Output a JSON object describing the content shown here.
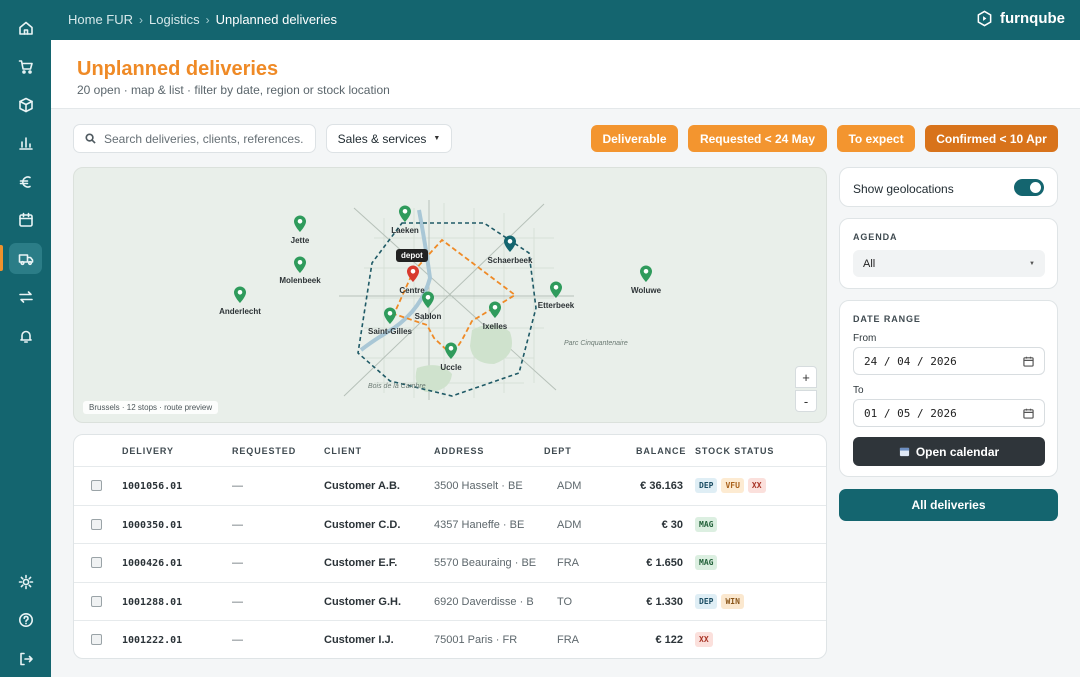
{
  "app": {
    "brand": "furnqube",
    "breadcrumb": [
      "Home FUR",
      "Logistics",
      "Unplanned deliveries"
    ]
  },
  "sidebar": {
    "items": [
      {
        "icon": "home-icon"
      },
      {
        "icon": "cart-icon"
      },
      {
        "icon": "box-icon"
      },
      {
        "icon": "bar-chart-icon"
      },
      {
        "icon": "euro-icon"
      },
      {
        "icon": "calendar-icon"
      },
      {
        "icon": "truck-icon",
        "active": true
      },
      {
        "icon": "transfer-icon"
      },
      {
        "icon": "bell-icon"
      },
      {
        "icon": "sun-icon"
      },
      {
        "icon": "help-icon"
      },
      {
        "icon": "logout-icon"
      }
    ]
  },
  "header": {
    "title": "Unplanned deliveries",
    "subtitle": "20 open · map & list · filter by date, region or stock location"
  },
  "toolbar": {
    "search_placeholder": "Search deliveries, clients, references...",
    "select_label": "Sales & services",
    "filters": [
      "Deliverable",
      "Requested < 24 May",
      "To expect",
      "Confirmed < 10 Apr"
    ]
  },
  "map": {
    "depot_label": "depot",
    "locations": {
      "laeken": "Laeken",
      "jette": "Jette",
      "molenbeek": "Molenbeek",
      "anderlecht": "Anderlecht",
      "schaerbeek": "Schaerbeek",
      "centre": "Centre",
      "sablon": "Sablon",
      "etterbeek": "Etterbeek",
      "woluwe": "Woluwe",
      "saint_gilles": "Saint-Gilles",
      "ixelles": "Ixelles",
      "uccle": "Uccle"
    },
    "parks": {
      "cinquantenaire": "Parc Cinquantenaire",
      "cambre": "Bois de la Cambre"
    },
    "caption": "Brussels · 12 stops · route preview",
    "zoom_in": "+",
    "zoom_out": "-",
    "colors": {
      "pin": "#2f9b5c",
      "depot": "#d83a2e",
      "schaerbeek": "#14656f",
      "route": "#ef8a26",
      "zone": "#1f5a66"
    }
  },
  "table": {
    "columns": [
      "DELIVERY",
      "REQUESTED",
      "CLIENT",
      "ADDRESS",
      "DEPT",
      "BALANCE",
      "STOCK STATUS"
    ],
    "rows": [
      {
        "delivery": "1001056.01",
        "requested": "—",
        "client": "Customer A.B.",
        "address": "3500 Hasselt · BE",
        "dept": "ADM",
        "balance": "€ 36.163",
        "stock": [
          "DEP",
          "VFU",
          "XX"
        ]
      },
      {
        "delivery": "1000350.01",
        "requested": "—",
        "client": "Customer C.D.",
        "address": "4357 Haneffe · BE",
        "dept": "ADM",
        "balance": "€ 30",
        "stock": [
          "MAG"
        ]
      },
      {
        "delivery": "1000426.01",
        "requested": "—",
        "client": "Customer E.F.",
        "address": "5570 Beauraing · BE",
        "dept": "FRA",
        "balance": "€ 1.650",
        "stock": [
          "MAG"
        ]
      },
      {
        "delivery": "1001288.01",
        "requested": "—",
        "client": "Customer G.H.",
        "address": "6920 Daverdisse · B",
        "dept": "TO",
        "balance": "€ 1.330",
        "stock": [
          "DEP",
          "WIN"
        ]
      },
      {
        "delivery": "1001222.01",
        "requested": "—",
        "client": "Customer I.J.",
        "address": "75001 Paris · FR",
        "dept": "FRA",
        "balance": "€ 122",
        "stock": [
          "XX"
        ]
      }
    ]
  },
  "panel": {
    "geo_label": "Show geolocations",
    "geo_enabled": true,
    "agenda_label": "AGENDA",
    "agenda_value": "All",
    "date_range_label": "DATE RANGE",
    "from_label": "From",
    "from_value": "24 / 04 / 2026",
    "to_label": "To",
    "to_value": "01 / 05 / 2026",
    "calendar_button": "Open calendar",
    "all_button": "All deliveries"
  },
  "colors": {
    "accent": "#ef8a26",
    "brand": "#14656f",
    "dark": "#2f353a"
  }
}
